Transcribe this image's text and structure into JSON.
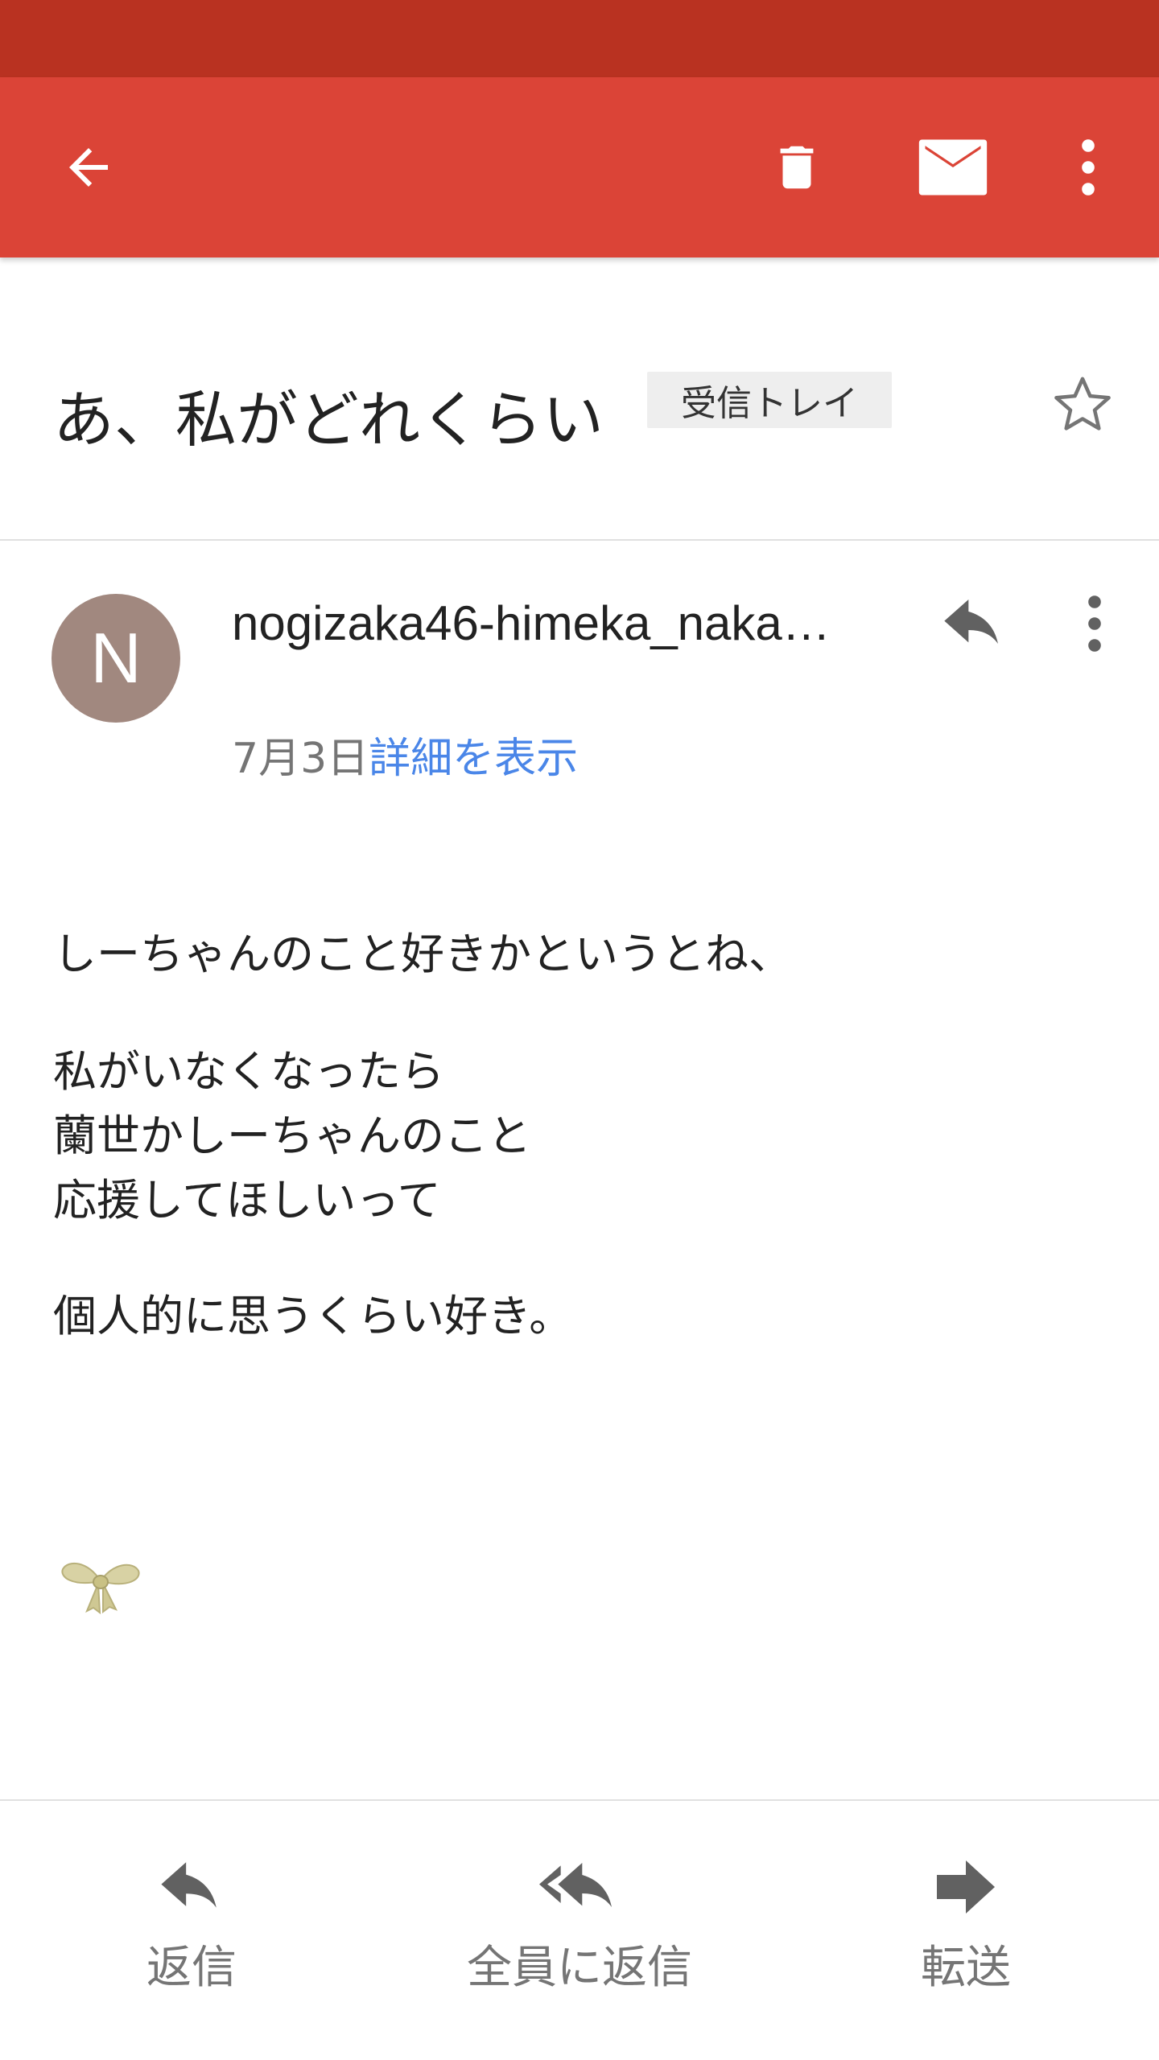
{
  "toolbar": {
    "back_icon": "arrow-back-icon",
    "delete_icon": "trash-icon",
    "mark_unread_icon": "mail-icon",
    "overflow_icon": "more-vert-icon",
    "color": "#db4437",
    "status_bar_color": "#b93221"
  },
  "subject": {
    "title": "あ、私がどれくらい",
    "label": "受信トレイ",
    "star_icon": "star-outline-icon"
  },
  "message": {
    "avatar_letter": "N",
    "avatar_color": "#a1887f",
    "sender": "nogizaka46-himeka_naka…",
    "date": "7月3日",
    "details_link": "詳細を表示",
    "body": {
      "line1": "しーちゃんのこと好きかというとね、",
      "line2": "私がいなくなったら",
      "line3": "蘭世かしーちゃんのこと",
      "line4": "応援してほしいって",
      "line5": "個人的に思うくらい好き。"
    }
  },
  "footer": {
    "reply": "返信",
    "reply_all": "全員に返信",
    "forward": "転送"
  }
}
